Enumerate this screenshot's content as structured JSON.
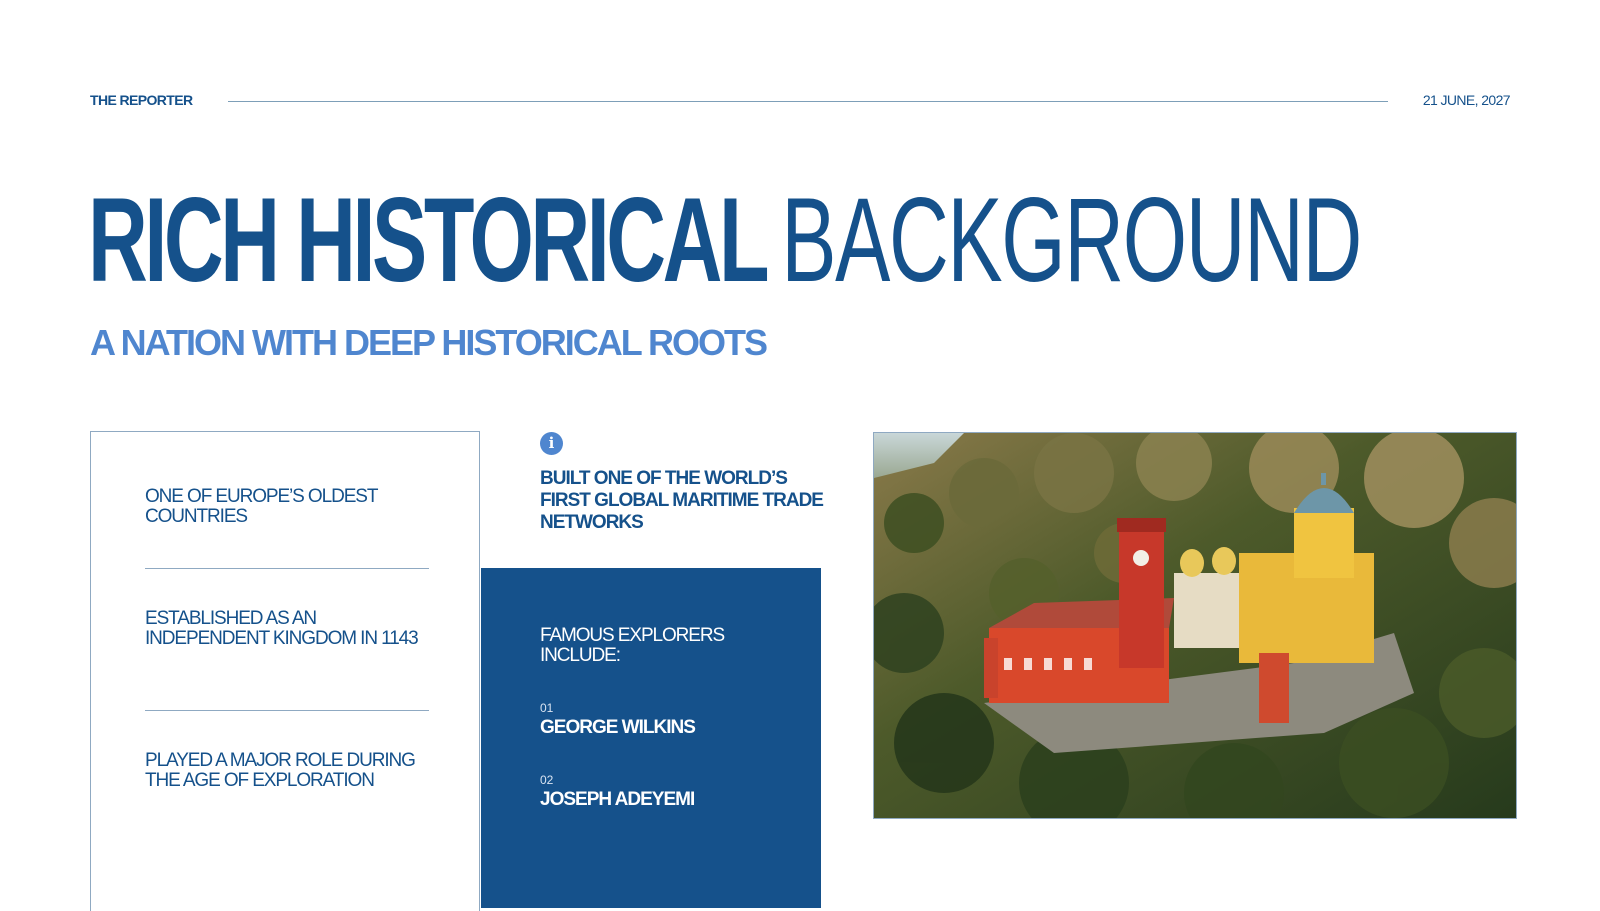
{
  "header": {
    "brand": "THE REPORTER",
    "date": "21 JUNE, 2027"
  },
  "title": {
    "bold_part": "RICH HISTORICAL",
    "light_part": "BACKGROUND"
  },
  "subtitle": "A NATION WITH DEEP HISTORICAL ROOTS",
  "facts": [
    "ONE OF EUROPE’S OLDEST COUNTRIES",
    "ESTABLISHED AS AN INDEPENDENT KINGDOM IN 1143",
    "PLAYED A MAJOR ROLE DURING THE AGE OF EXPLORATION"
  ],
  "info": {
    "icon": "info-icon",
    "text": "BUILT ONE OF THE WORLD’S FIRST GLOBAL MARITIME TRADE NETWORKS"
  },
  "explorers": {
    "heading": "FAMOUS EXPLORERS INCLUDE:",
    "items": [
      {
        "number": "01",
        "name": "GEORGE WILKINS"
      },
      {
        "number": "02",
        "name": "JOSEPH ADEYEMI"
      }
    ]
  },
  "photo": {
    "subject": "aerial view of a colorful red and yellow palace on a forested hilltop"
  },
  "colors": {
    "primary": "#15518b",
    "accent": "#4f86cf",
    "rule": "#8fa9c2",
    "background": "#ffffff"
  }
}
